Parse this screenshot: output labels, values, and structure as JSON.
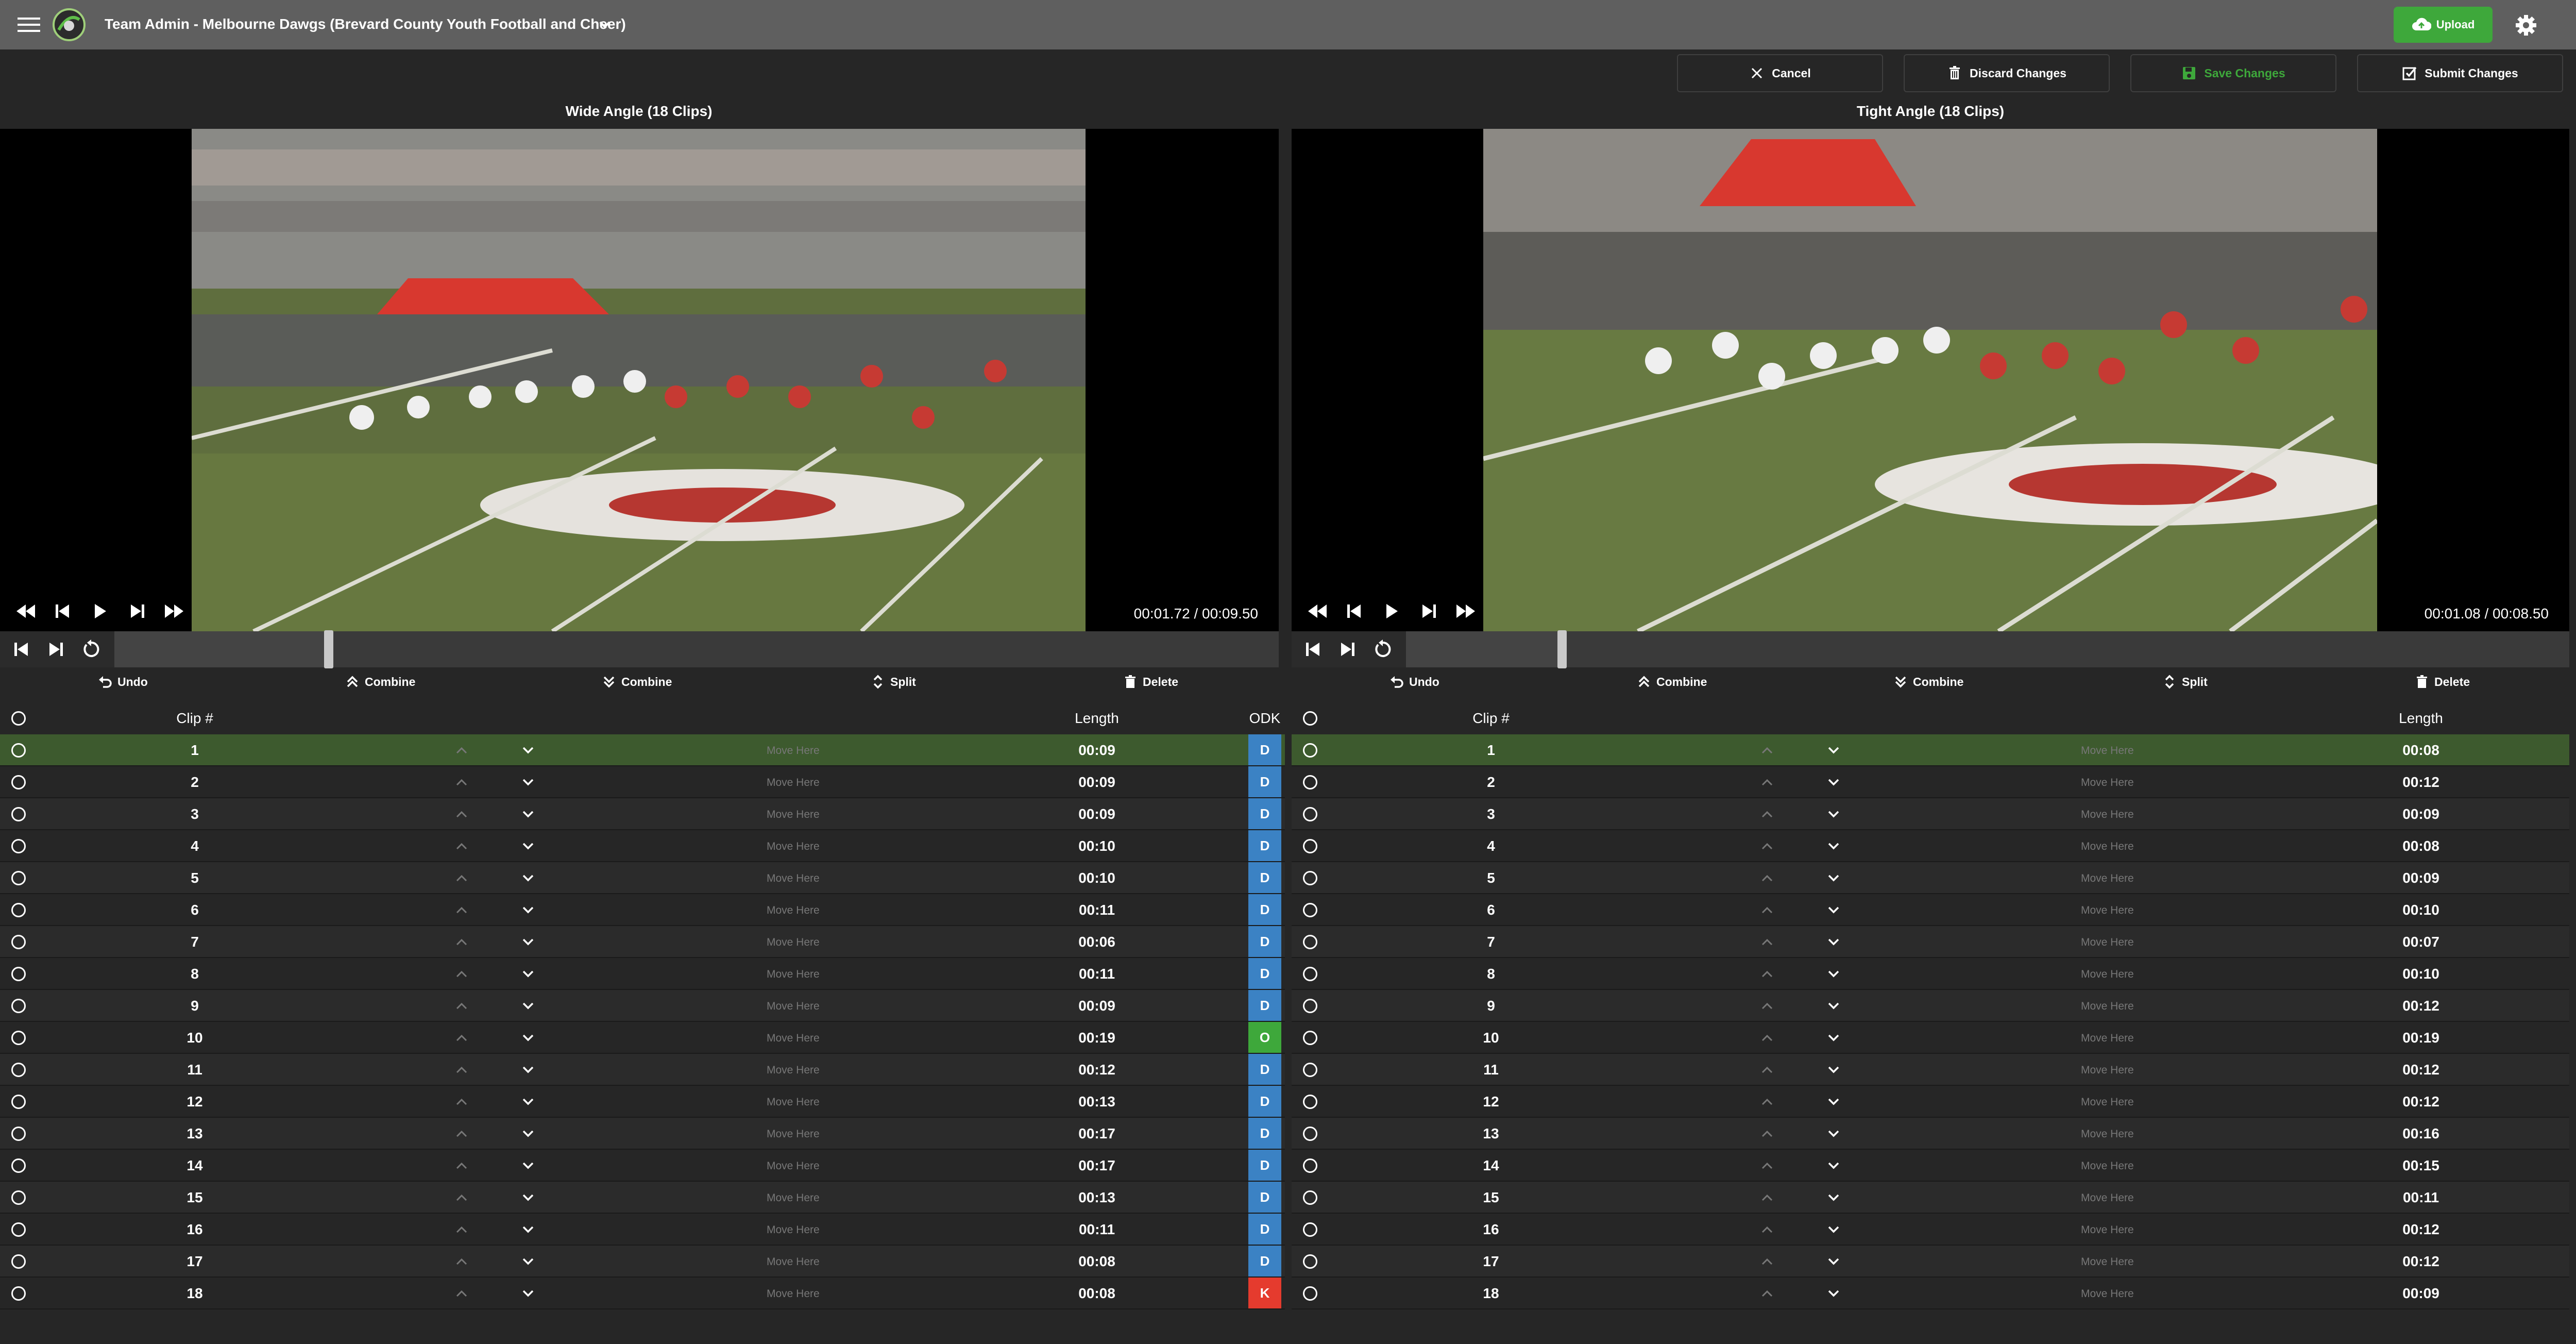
{
  "topbar": {
    "title": "Team Admin - Melbourne Dawgs (Brevard County Youth Football and Cheer)",
    "upload_label": "Upload"
  },
  "actions": {
    "cancel": "Cancel",
    "discard": "Discard Changes",
    "save": "Save Changes",
    "submit": "Submit Changes"
  },
  "colors": {
    "upload_green": "#3ea83b",
    "selected_row": "#3d5a2e",
    "odk_d": "#3b82c4",
    "odk_o": "#3ea83b",
    "odk_k": "#e53b2e"
  },
  "wide": {
    "title": "Wide Angle (18 Clips)",
    "time": "00:01.72 / 00:09.50",
    "progress": 0.18
  },
  "tight": {
    "title": "Tight Angle (18 Clips)",
    "time": "00:01.08 / 00:08.50",
    "progress": 0.13
  },
  "edit": {
    "undo": "Undo",
    "combine_up": "Combine",
    "combine_down": "Combine",
    "split": "Split",
    "delete": "Delete"
  },
  "table": {
    "clip_header": "Clip #",
    "length_header": "Length",
    "odk_header": "ODK",
    "move_here": "Move Here"
  },
  "wide_clips": [
    {
      "num": "1",
      "len": "00:09",
      "odk": "D"
    },
    {
      "num": "2",
      "len": "00:09",
      "odk": "D"
    },
    {
      "num": "3",
      "len": "00:09",
      "odk": "D"
    },
    {
      "num": "4",
      "len": "00:10",
      "odk": "D"
    },
    {
      "num": "5",
      "len": "00:10",
      "odk": "D"
    },
    {
      "num": "6",
      "len": "00:11",
      "odk": "D"
    },
    {
      "num": "7",
      "len": "00:06",
      "odk": "D"
    },
    {
      "num": "8",
      "len": "00:11",
      "odk": "D"
    },
    {
      "num": "9",
      "len": "00:09",
      "odk": "D"
    },
    {
      "num": "10",
      "len": "00:19",
      "odk": "O"
    },
    {
      "num": "11",
      "len": "00:12",
      "odk": "D"
    },
    {
      "num": "12",
      "len": "00:13",
      "odk": "D"
    },
    {
      "num": "13",
      "len": "00:17",
      "odk": "D"
    },
    {
      "num": "14",
      "len": "00:17",
      "odk": "D"
    },
    {
      "num": "15",
      "len": "00:13",
      "odk": "D"
    },
    {
      "num": "16",
      "len": "00:11",
      "odk": "D"
    },
    {
      "num": "17",
      "len": "00:08",
      "odk": "D"
    },
    {
      "num": "18",
      "len": "00:08",
      "odk": "K"
    }
  ],
  "tight_clips": [
    {
      "num": "1",
      "len": "00:08"
    },
    {
      "num": "2",
      "len": "00:12"
    },
    {
      "num": "3",
      "len": "00:09"
    },
    {
      "num": "4",
      "len": "00:08"
    },
    {
      "num": "5",
      "len": "00:09"
    },
    {
      "num": "6",
      "len": "00:10"
    },
    {
      "num": "7",
      "len": "00:07"
    },
    {
      "num": "8",
      "len": "00:10"
    },
    {
      "num": "9",
      "len": "00:12"
    },
    {
      "num": "10",
      "len": "00:19"
    },
    {
      "num": "11",
      "len": "00:12"
    },
    {
      "num": "12",
      "len": "00:12"
    },
    {
      "num": "13",
      "len": "00:16"
    },
    {
      "num": "14",
      "len": "00:15"
    },
    {
      "num": "15",
      "len": "00:11"
    },
    {
      "num": "16",
      "len": "00:12"
    },
    {
      "num": "17",
      "len": "00:12"
    },
    {
      "num": "18",
      "len": "00:09"
    }
  ]
}
